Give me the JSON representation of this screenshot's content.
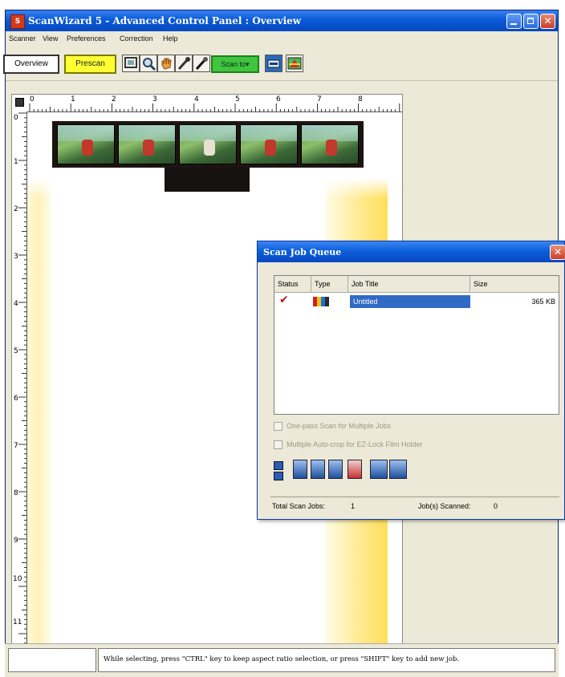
{
  "window": {
    "title": "ScanWizard 5 - Advanced Control Panel : Overview"
  },
  "menu": [
    "Scanner",
    "View",
    "Preferences",
    "Correction",
    "Help"
  ],
  "toolbar": {
    "overview_label": "Overview",
    "prescan_label": "Prescan",
    "scan_to_label": "Scan to▾"
  },
  "ruler": {
    "horizontal": [
      "0",
      "1",
      "2",
      "3",
      "4",
      "5",
      "6",
      "7",
      "8"
    ],
    "vertical": [
      "0",
      "1",
      "2",
      "3",
      "4",
      "5",
      "6",
      "7",
      "8",
      "9",
      "10",
      "11"
    ]
  },
  "status_bar": {
    "message": "While selecting, press \"CTRL\" key to keep aspect ratio selection, or press \"SHIFT\" key to add new job."
  },
  "queue": {
    "title": "Scan Job Queue",
    "columns": [
      "Status",
      "Type",
      "Job Title",
      "Size"
    ],
    "jobs": [
      {
        "title": "Untitled",
        "size": "365 KB"
      }
    ],
    "option1": "One-pass Scan for Multiple Jobs",
    "option2": "Multiple Auto-crop for EZ-Lock Film Holder",
    "total_label": "Total Scan Jobs:",
    "total_value": "1",
    "scanned_label": "Job(s) Scanned:",
    "scanned_value": "0"
  },
  "colors": {
    "title_bar": "#0a5bd6",
    "prescan": "#ffff33",
    "scan_to": "#3fc53f",
    "selection": "#316ac5"
  }
}
